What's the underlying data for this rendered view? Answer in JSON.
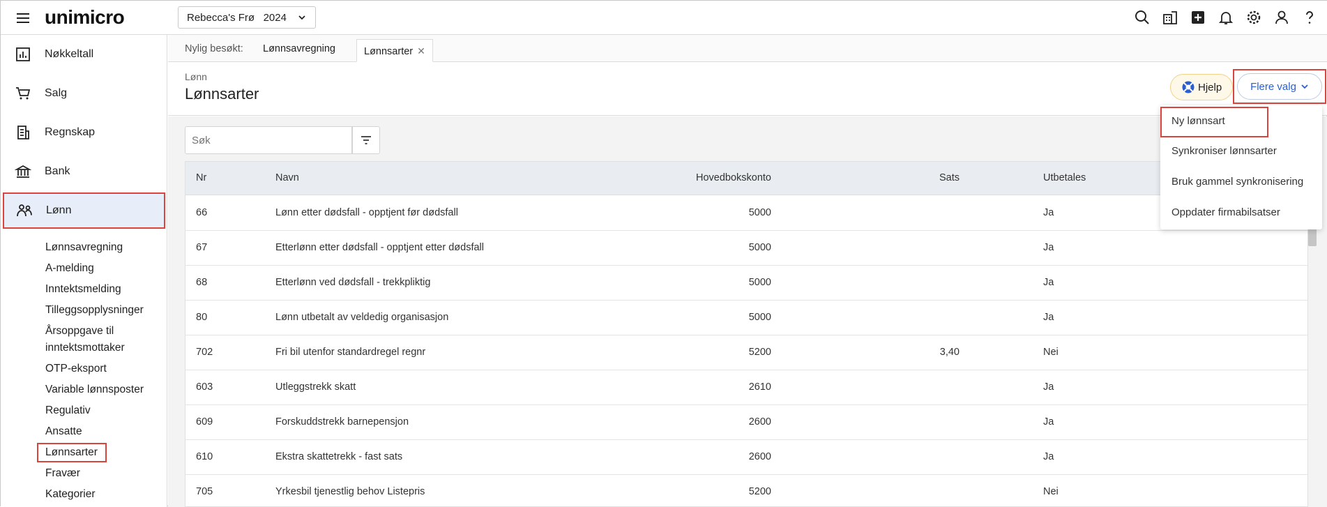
{
  "topbar": {
    "logo": "unimicro",
    "company_name": "Rebecca's Frø",
    "company_year": "2024",
    "icons": [
      "search-icon",
      "building-icon",
      "plus-square-icon",
      "bell-icon",
      "gear-icon",
      "user-icon",
      "help-icon"
    ]
  },
  "sidebar": {
    "items": [
      {
        "label": "Nøkkeltall",
        "icon": "bar-chart-icon"
      },
      {
        "label": "Salg",
        "icon": "cart-icon"
      },
      {
        "label": "Regnskap",
        "icon": "ledger-icon"
      },
      {
        "label": "Bank",
        "icon": "bank-icon"
      },
      {
        "label": "Lønn",
        "icon": "people-icon"
      }
    ],
    "subitems": [
      "Lønnsavregning",
      "A-melding",
      "Inntektsmelding",
      "Tilleggsopplysninger",
      "Årsoppgave til",
      "inntektsmottaker",
      "OTP-eksport",
      "Variable lønnsposter",
      "Regulativ",
      "Ansatte",
      "Lønnsarter",
      "Fravær",
      "Kategorier"
    ]
  },
  "tabs": {
    "recent_label": "Nylig besøkt:",
    "items": [
      "Lønnsavregning",
      "Lønnsarter"
    ]
  },
  "header": {
    "breadcrumb": "Lønn",
    "title": "Lønnsarter",
    "help_label": "Hjelp",
    "more_label": "Flere valg"
  },
  "search": {
    "placeholder": "Søk"
  },
  "table": {
    "columns": [
      "Nr",
      "Navn",
      "Hovedbokskonto",
      "Sats",
      "Utbetales"
    ],
    "rows": [
      {
        "nr": "66",
        "navn": "Lønn etter dødsfall - opptjent før dødsfall",
        "konto": "5000",
        "sats": "",
        "utbetales": "Ja"
      },
      {
        "nr": "67",
        "navn": "Etterlønn etter dødsfall - opptjent etter dødsfall",
        "konto": "5000",
        "sats": "",
        "utbetales": "Ja"
      },
      {
        "nr": "68",
        "navn": "Etterlønn ved dødsfall - trekkpliktig",
        "konto": "5000",
        "sats": "",
        "utbetales": "Ja"
      },
      {
        "nr": "80",
        "navn": "Lønn utbetalt av veldedig organisasjon",
        "konto": "5000",
        "sats": "",
        "utbetales": "Ja"
      },
      {
        "nr": "702",
        "navn": "Fri bil utenfor standardregel regnr",
        "konto": "5200",
        "sats": "3,40",
        "utbetales": "Nei"
      },
      {
        "nr": "603",
        "navn": "Utleggstrekk skatt",
        "konto": "2610",
        "sats": "",
        "utbetales": "Ja"
      },
      {
        "nr": "609",
        "navn": "Forskuddstrekk barnepensjon",
        "konto": "2600",
        "sats": "",
        "utbetales": "Ja"
      },
      {
        "nr": "610",
        "navn": "Ekstra skattetrekk - fast sats",
        "konto": "2600",
        "sats": "",
        "utbetales": "Ja"
      },
      {
        "nr": "705",
        "navn": "Yrkesbil tjenestlig behov Listepris",
        "konto": "5200",
        "sats": "",
        "utbetales": "Nei"
      }
    ]
  },
  "dropdown": {
    "items": [
      "Ny lønnsart",
      "Synkroniser lønnsarter",
      "Bruk gammel synkronisering",
      "Oppdater firmabilsatser"
    ]
  },
  "colors": {
    "accent": "#2b5fcf",
    "highlight_border": "#d9453d",
    "active_bg": "#e8eef9"
  }
}
